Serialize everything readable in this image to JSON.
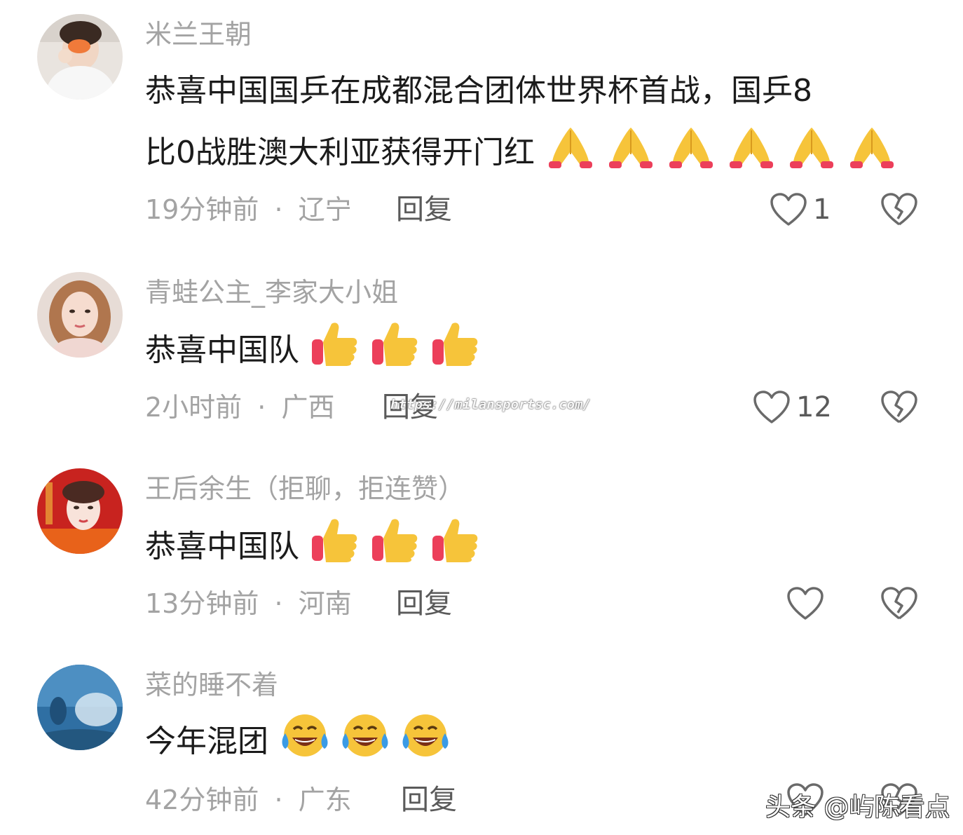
{
  "comments": [
    {
      "username": "米兰王朝",
      "text_line1": "恭喜中国国乒在成都混合团体世界杯首战，国乒8",
      "text_line2": "比0战胜澳大利亚获得开门红",
      "emoji": "folded-hands-icon",
      "emoji_count": 6,
      "time": "19分钟前",
      "sep": "·",
      "location": "辽宁",
      "reply_label": "回复",
      "likes": "1"
    },
    {
      "username": "青蛙公主_李家大小姐",
      "text": "恭喜中国队",
      "emoji": "thumbs-up-icon",
      "emoji_count": 3,
      "time": "2小时前",
      "sep": "·",
      "location": "广西",
      "reply_label": "回复",
      "likes": "12"
    },
    {
      "username": "王后余生（拒聊，拒连赞）",
      "text": "恭喜中国队",
      "emoji": "thumbs-up-icon",
      "emoji_count": 3,
      "time": "13分钟前",
      "sep": "·",
      "location": "河南",
      "reply_label": "回复",
      "likes": ""
    },
    {
      "username": "菜的睡不着",
      "text": "今年混团",
      "emoji": "tears-of-joy-icon",
      "emoji_count": 3,
      "time": "42分钟前",
      "sep": "·",
      "location": "广东",
      "reply_label": "回复",
      "likes": ""
    }
  ],
  "watermarks": {
    "url": "https://milansportsc.com/",
    "brand": "头条 @屿陈看点"
  },
  "colors": {
    "text": "#1b1b1b",
    "muted": "#a3a3a3",
    "action": "#5a5a5a"
  }
}
